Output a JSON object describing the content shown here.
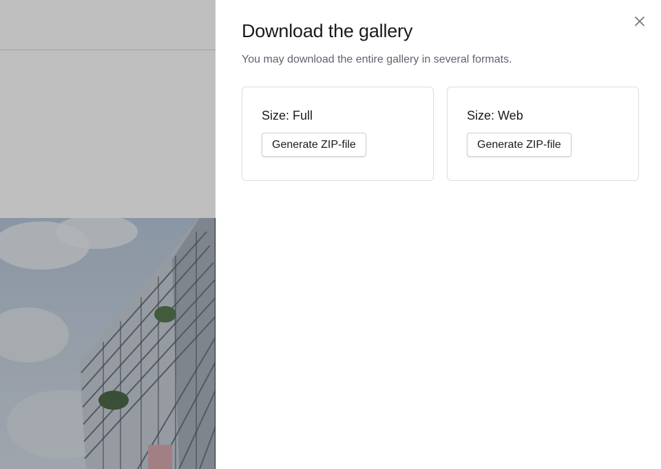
{
  "drawer": {
    "title": "Download the gallery",
    "subtitle": "You may download the entire gallery in several formats.",
    "close_icon": "close-icon",
    "options": [
      {
        "size_label": "Size: Full",
        "button_label": "Generate ZIP-file"
      },
      {
        "size_label": "Size: Web",
        "button_label": "Generate ZIP-file"
      }
    ]
  },
  "background": {
    "photo_subject": "apartment-building-photo"
  },
  "colors": {
    "overlay": "#000000",
    "text_primary": "#1a1a1a",
    "text_secondary": "#5f6270",
    "border": "#dcdcdc"
  }
}
